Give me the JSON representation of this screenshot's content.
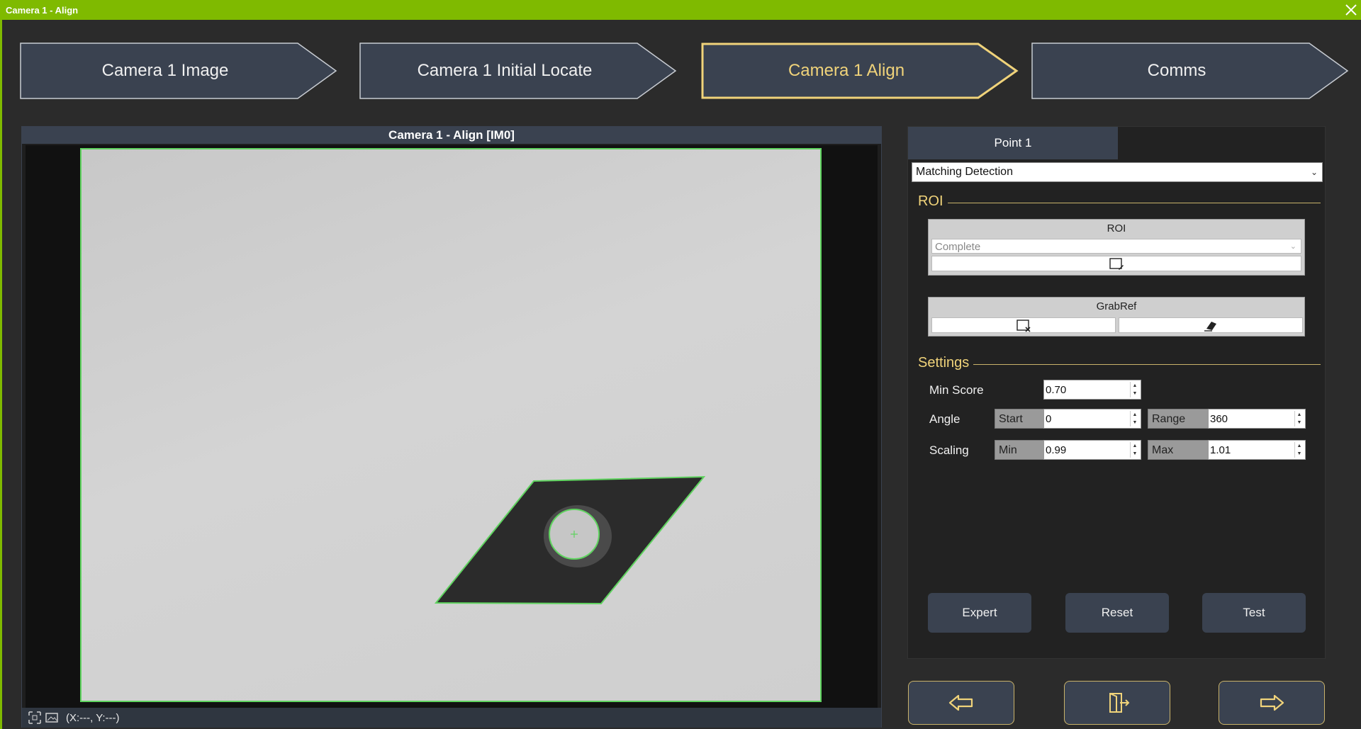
{
  "window": {
    "title": "Camera 1 - Align"
  },
  "steps": [
    {
      "label": "Camera 1 Image",
      "active": false
    },
    {
      "label": "Camera 1 Initial Locate",
      "active": false
    },
    {
      "label": "Camera 1 Align",
      "active": true
    },
    {
      "label": "Comms",
      "active": false
    }
  ],
  "viewer": {
    "title": "Camera 1 - Align  [IM0]",
    "coords": "(X:---, Y:---)"
  },
  "panel": {
    "tab": "Point 1",
    "detection_mode": "Matching Detection",
    "roi_section": "ROI",
    "roi_box": {
      "title": "ROI",
      "shape_value": "Complete"
    },
    "grabref_box": {
      "title": "GrabRef"
    },
    "settings_section": "Settings",
    "settings": {
      "min_score_label": "Min Score",
      "min_score": "0.70",
      "angle_label": "Angle",
      "angle_start_label": "Start",
      "angle_start": "0",
      "angle_range_label": "Range",
      "angle_range": "360",
      "scaling_label": "Scaling",
      "scaling_min_label": "Min",
      "scaling_min": "0.99",
      "scaling_max_label": "Max",
      "scaling_max": "1.01"
    },
    "buttons": {
      "expert": "Expert",
      "reset": "Reset",
      "test": "Test"
    }
  },
  "colors": {
    "accent": "#7fba00",
    "highlight": "#f0d37a",
    "panel_blue": "#3a4250",
    "detection_green": "#5fd35f"
  },
  "icons": {
    "close": "close-icon",
    "back": "arrow-left-icon",
    "exit": "exit-door-icon",
    "next": "arrow-right-icon"
  }
}
